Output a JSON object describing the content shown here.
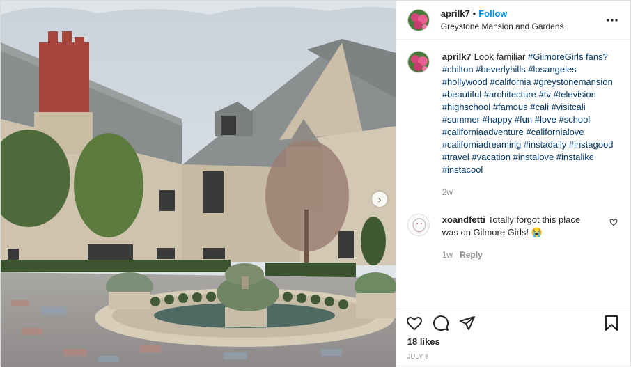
{
  "header": {
    "username": "aprilk7",
    "separator": "•",
    "follow_label": "Follow",
    "location": "Greystone Mansion and Gardens",
    "more_icon": "more-horizontal-icon"
  },
  "caption": {
    "username": "aprilk7",
    "text": "Look familiar ",
    "hashtags": "#GilmoreGirls fans? #chilton #beverlyhills #losangeles #hollywood #california #greystonemansion #beautiful #architecture #tv #television #highschool #famous #cali #visitcali #summer #happy #fun #love #school #californiaadventure #californialove #californiadreaming #instadaily #instagood #travel #vacation #instalove #instalike #instacool",
    "time": "2w"
  },
  "comments": [
    {
      "username": "xoandfetti",
      "text": "Totally forgot this place was on Gilmore Girls! 😭",
      "time": "1w",
      "reply_label": "Reply"
    }
  ],
  "actions": {
    "like_icon": "heart-icon",
    "comment_icon": "comment-icon",
    "share_icon": "share-icon",
    "save_icon": "bookmark-icon"
  },
  "likes": "18 likes",
  "date": "JULY 8",
  "photo": {
    "next_icon": "chevron-right-icon",
    "next_glyph": "›"
  },
  "colors": {
    "link": "#00376b",
    "follow": "#0095f6",
    "muted": "#8e8e8e"
  }
}
